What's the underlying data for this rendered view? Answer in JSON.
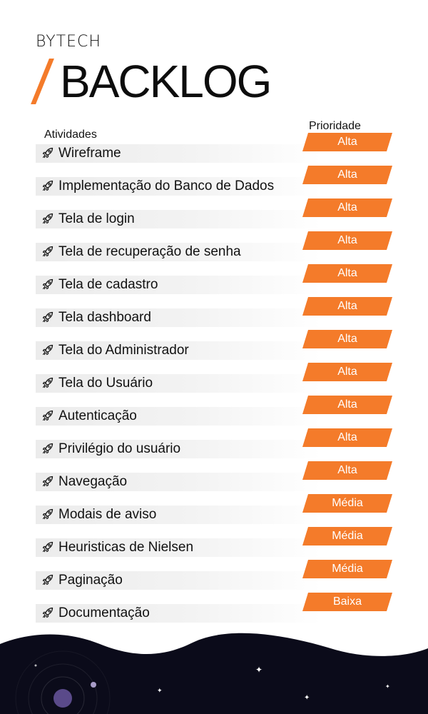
{
  "brand": "BYTECH",
  "title": "BACKLOG",
  "headers": {
    "activities": "Atividades",
    "priority": "Prioridade"
  },
  "items": [
    {
      "label": "Wireframe",
      "priority": "Alta"
    },
    {
      "label": "Implementação do Banco de Dados",
      "priority": "Alta"
    },
    {
      "label": "Tela de login",
      "priority": "Alta"
    },
    {
      "label": "Tela de recuperação de senha",
      "priority": "Alta"
    },
    {
      "label": "Tela de cadastro",
      "priority": "Alta"
    },
    {
      "label": "Tela dashboard",
      "priority": "Alta"
    },
    {
      "label": "Tela do Administrador",
      "priority": "Alta"
    },
    {
      "label": "Tela do Usuário",
      "priority": "Alta"
    },
    {
      "label": "Autenticação",
      "priority": "Alta"
    },
    {
      "label": "Privilégio do usuário",
      "priority": "Alta"
    },
    {
      "label": "Navegação",
      "priority": "Alta"
    },
    {
      "label": "Modais de aviso",
      "priority": "Média"
    },
    {
      "label": "Heuristicas de Nielsen",
      "priority": "Média"
    },
    {
      "label": "Paginação",
      "priority": "Média"
    },
    {
      "label": "Documentação",
      "priority": "Baixa"
    }
  ],
  "icon": "rocket-icon",
  "colors": {
    "accent": "#f47b2a",
    "text": "#111111",
    "space": "#0b0b1a"
  }
}
